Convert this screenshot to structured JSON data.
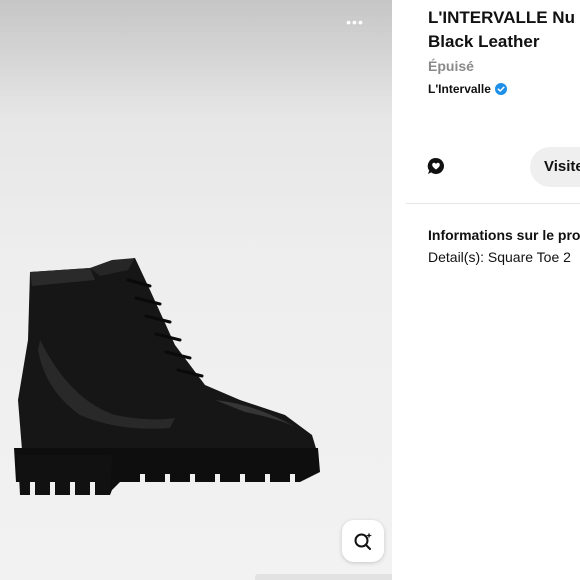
{
  "product": {
    "title_line1": "L'INTERVALLE Nu",
    "title_line2": "Black Leather",
    "stock_status": "Épuisé",
    "brand": "L'Intervalle"
  },
  "actions": {
    "visit_label": "Visite",
    "more_label": "•••"
  },
  "info": {
    "heading": "Informations sur le pro",
    "detail": "Detail(s): Square Toe 2"
  },
  "icons": {
    "more": "more-dots-icon",
    "lens": "visual-search-icon",
    "comment": "comment-heart-icon",
    "verified": "verified-badge-icon"
  },
  "colors": {
    "verified_blue": "#1d8fe6",
    "boot_black": "#141414",
    "button_gray": "#efefef"
  }
}
